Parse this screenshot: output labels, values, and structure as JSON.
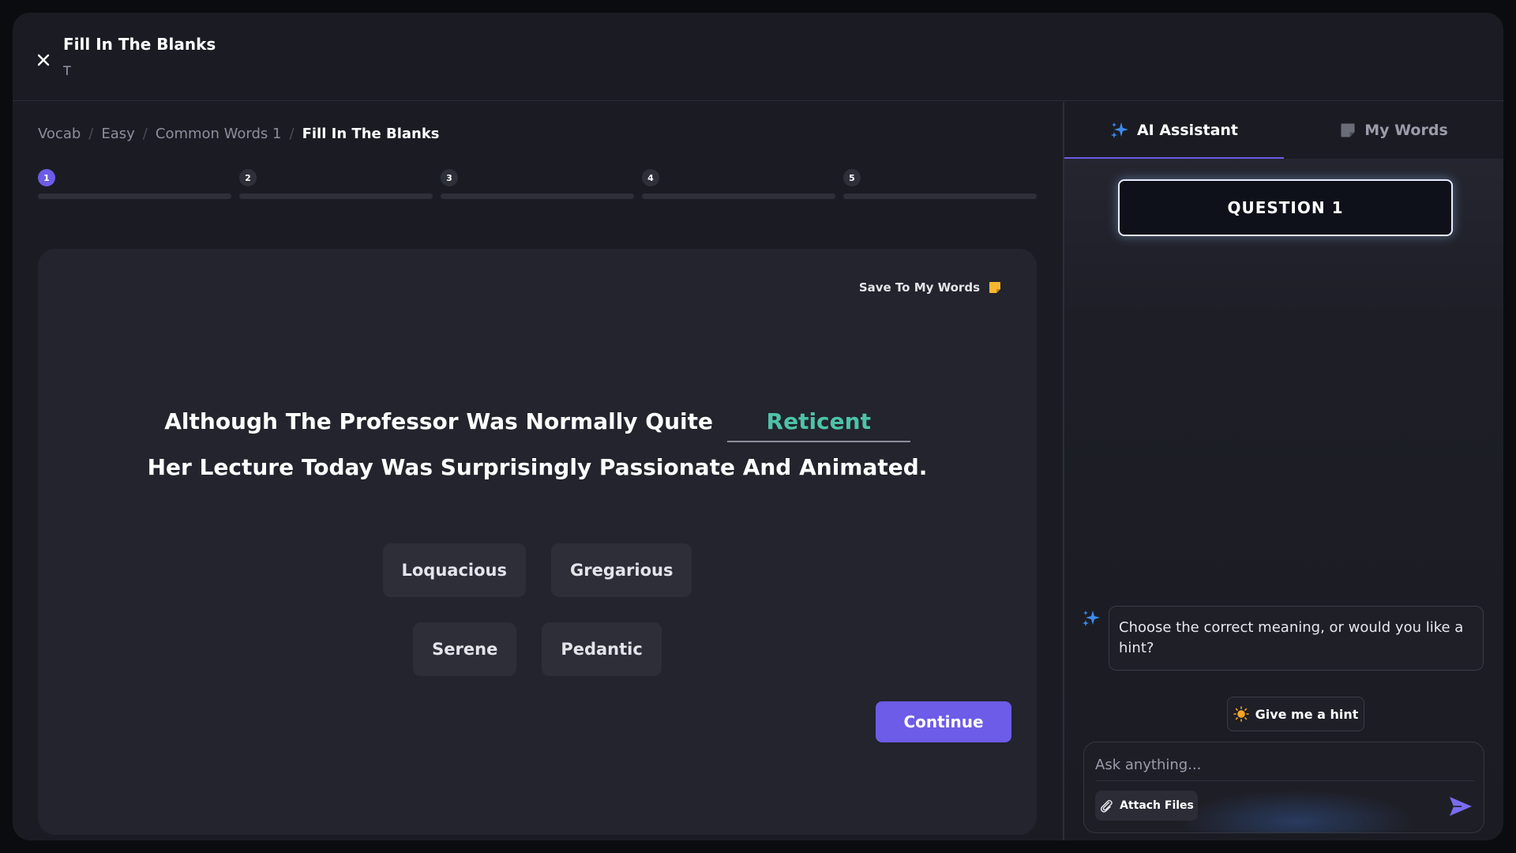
{
  "header": {
    "title": "Fill In The Blanks",
    "subtitle": "T",
    "close_icon": "close-icon"
  },
  "breadcrumb": [
    "Vocab",
    "Easy",
    "Common Words 1",
    "Fill In The Blanks"
  ],
  "progress": {
    "steps": [
      "1",
      "2",
      "3",
      "4",
      "5"
    ],
    "current_step": 1
  },
  "card": {
    "save_label": "Save To My Words",
    "save_icon": "note-icon",
    "sentence_part1": "Although The Professor Was Normally Quite",
    "blank_value": "Reticent",
    "sentence_part2": "Her Lecture Today Was Surprisingly Passionate And Animated.",
    "options": [
      "Loquacious",
      "Gregarious",
      "Serene",
      "Pedantic"
    ],
    "continue_label": "Continue"
  },
  "assistant": {
    "tabs": [
      {
        "label": "AI Assistant",
        "icon": "sparkle-icon",
        "active": true
      },
      {
        "label": "My Words",
        "icon": "note-icon",
        "active": false
      }
    ],
    "question_label": "QUESTION 1",
    "bot_message": "Choose the correct meaning, or would you like a hint?",
    "hint_label": "Give me a hint",
    "input_placeholder": "Ask anything...",
    "attach_label": "Attach Files"
  },
  "colors": {
    "accent": "#6c5ce7",
    "answer": "#4ec2a8",
    "note": "#f5b731"
  }
}
